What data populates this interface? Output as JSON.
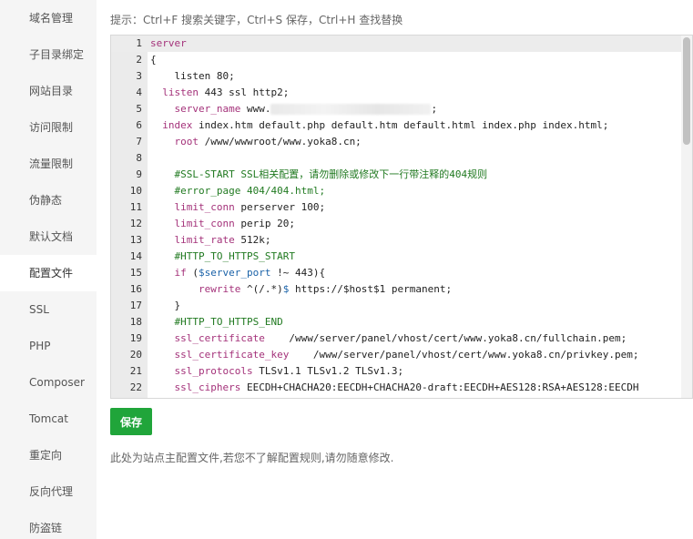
{
  "sidebar": {
    "items": [
      {
        "label": "域名管理"
      },
      {
        "label": "子目录绑定"
      },
      {
        "label": "网站目录"
      },
      {
        "label": "访问限制"
      },
      {
        "label": "流量限制"
      },
      {
        "label": "伪静态"
      },
      {
        "label": "默认文档"
      },
      {
        "label": "配置文件",
        "active": true
      },
      {
        "label": "SSL"
      },
      {
        "label": "PHP"
      },
      {
        "label": "Composer"
      },
      {
        "label": "Tomcat"
      },
      {
        "label": "重定向"
      },
      {
        "label": "反向代理"
      },
      {
        "label": "防盗链"
      }
    ]
  },
  "hint": "提示：Ctrl+F 搜索关键字，Ctrl+S 保存，Ctrl+H 查找替换",
  "editor": {
    "lines": [
      {
        "n": "1",
        "parts": [
          [
            "kw",
            "server"
          ]
        ]
      },
      {
        "n": "2",
        "parts": [
          [
            "val",
            "{"
          ]
        ]
      },
      {
        "n": "3",
        "parts": [
          [
            "val",
            "    listen 80;"
          ]
        ]
      },
      {
        "n": "4",
        "parts": [
          [
            "val",
            "  "
          ],
          [
            "kw",
            "listen"
          ],
          [
            "val",
            " 443 ssl http2;"
          ]
        ]
      },
      {
        "n": "5",
        "parts": [
          [
            "val",
            "    "
          ],
          [
            "kw",
            "server_name"
          ],
          [
            "val",
            " www."
          ],
          [
            "blur",
            ""
          ],
          [
            "val",
            ";"
          ]
        ]
      },
      {
        "n": "6",
        "parts": [
          [
            "val",
            "  "
          ],
          [
            "kw",
            "index"
          ],
          [
            "val",
            " index.htm default.php default.htm default.html index.php index.html;"
          ]
        ]
      },
      {
        "n": "7",
        "parts": [
          [
            "val",
            "    "
          ],
          [
            "kw",
            "root"
          ],
          [
            "val",
            " /www/wwwroot/www.yoka8.cn;"
          ]
        ]
      },
      {
        "n": "8",
        "parts": [
          [
            "val",
            ""
          ]
        ]
      },
      {
        "n": "9",
        "parts": [
          [
            "val",
            "    "
          ],
          [
            "cmt",
            "#SSL-START SSL相关配置，请勿删除或修改下一行带注释的404规则"
          ]
        ]
      },
      {
        "n": "10",
        "parts": [
          [
            "val",
            "    "
          ],
          [
            "cmt",
            "#error_page 404/404.html;"
          ]
        ]
      },
      {
        "n": "11",
        "parts": [
          [
            "val",
            "    "
          ],
          [
            "kw",
            "limit_conn"
          ],
          [
            "val",
            " perserver 100;"
          ]
        ]
      },
      {
        "n": "12",
        "parts": [
          [
            "val",
            "    "
          ],
          [
            "kw",
            "limit_conn"
          ],
          [
            "val",
            " perip 20;"
          ]
        ]
      },
      {
        "n": "13",
        "parts": [
          [
            "val",
            "    "
          ],
          [
            "kw",
            "limit_rate"
          ],
          [
            "val",
            " 512k;"
          ]
        ]
      },
      {
        "n": "14",
        "parts": [
          [
            "val",
            "    "
          ],
          [
            "cmt",
            "#HTTP_TO_HTTPS_START"
          ]
        ]
      },
      {
        "n": "15",
        "parts": [
          [
            "val",
            "    "
          ],
          [
            "kw",
            "if"
          ],
          [
            "val",
            " ("
          ],
          [
            "var",
            "$server_port"
          ],
          [
            "val",
            " !~ 443){"
          ]
        ]
      },
      {
        "n": "16",
        "parts": [
          [
            "val",
            "        "
          ],
          [
            "kw",
            "rewrite"
          ],
          [
            "val",
            " ^(/.*)"
          ],
          [
            "var",
            "$"
          ],
          [
            "val",
            " https://$host$1 permanent;"
          ]
        ]
      },
      {
        "n": "17",
        "parts": [
          [
            "val",
            "    }"
          ]
        ]
      },
      {
        "n": "18",
        "parts": [
          [
            "val",
            "    "
          ],
          [
            "cmt",
            "#HTTP_TO_HTTPS_END"
          ]
        ]
      },
      {
        "n": "19",
        "parts": [
          [
            "val",
            "    "
          ],
          [
            "kw",
            "ssl_certificate"
          ],
          [
            "val",
            "    /www/server/panel/vhost/cert/www.yoka8.cn/fullchain.pem;"
          ]
        ]
      },
      {
        "n": "20",
        "parts": [
          [
            "val",
            "    "
          ],
          [
            "kw",
            "ssl_certificate_key"
          ],
          [
            "val",
            "    /www/server/panel/vhost/cert/www.yoka8.cn/privkey.pem;"
          ]
        ]
      },
      {
        "n": "21",
        "parts": [
          [
            "val",
            "    "
          ],
          [
            "kw",
            "ssl_protocols"
          ],
          [
            "val",
            " TLSv1.1 TLSv1.2 TLSv1.3;"
          ]
        ]
      },
      {
        "n": "22",
        "parts": [
          [
            "val",
            "    "
          ],
          [
            "kw",
            "ssl_ciphers"
          ],
          [
            "val",
            " EECDH+CHACHA20:EECDH+CHACHA20-draft:EECDH+AES128:RSA+AES128:EECDH"
          ]
        ]
      }
    ]
  },
  "save_label": "保存",
  "note": "此处为站点主配置文件,若您不了解配置规则,请勿随意修改.",
  "colors": {
    "accent": "#20a53a",
    "keyword": "#a4327a",
    "comment": "#217a21",
    "variable": "#1a62a8"
  }
}
